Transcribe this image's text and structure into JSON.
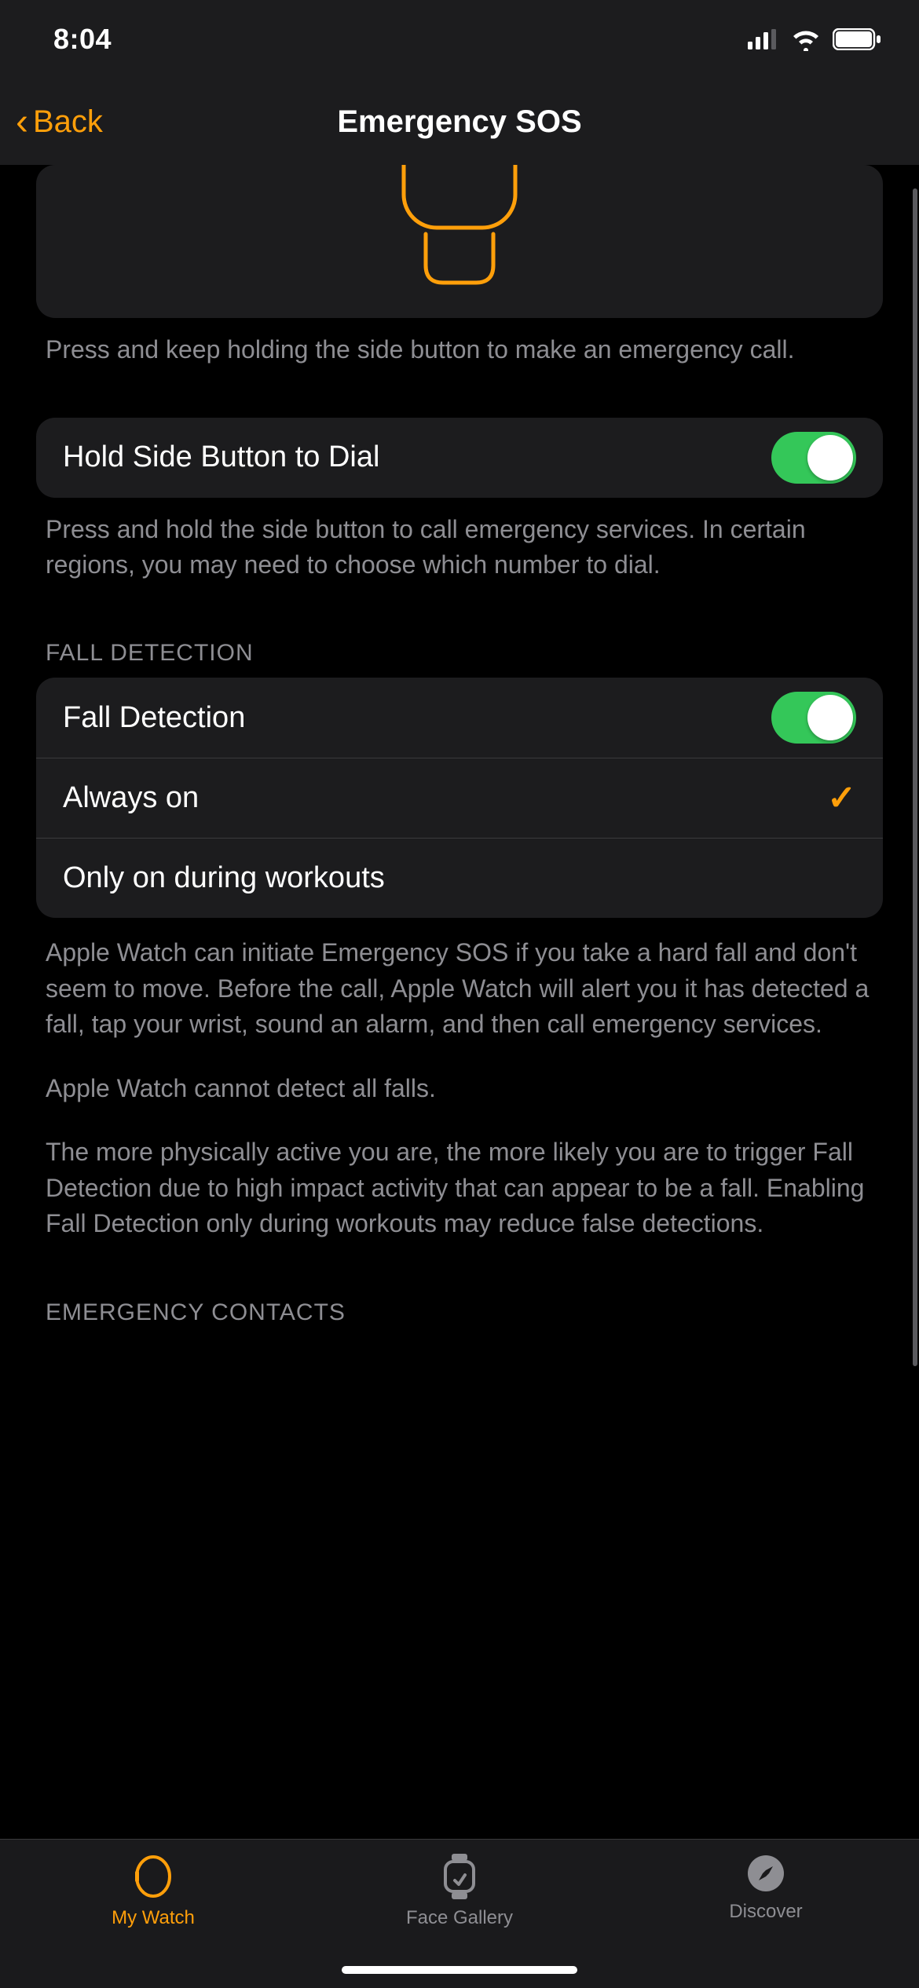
{
  "status": {
    "time": "8:04"
  },
  "nav": {
    "back": "Back",
    "title": "Emergency SOS"
  },
  "hero_footer": "Press and keep holding the side button to make an emergency call.",
  "hold_row": {
    "label": "Hold Side Button to Dial",
    "on": true
  },
  "hold_footer": "Press and hold the side button to call emergency services. In certain regions, you may need to choose which number to dial.",
  "fall_header": "FALL DETECTION",
  "fall": {
    "toggle_label": "Fall Detection",
    "toggle_on": true,
    "opt_always": "Always on",
    "opt_workouts": "Only on during workouts",
    "selected": "always"
  },
  "fall_footer": {
    "p1": "Apple Watch can initiate Emergency SOS if you take a hard fall and don't seem to move. Before the call, Apple Watch will alert you it has detected a fall, tap your wrist, sound an alarm, and then call emergency services.",
    "p2": "Apple Watch cannot detect all falls.",
    "p3": "The more physically active you are, the more likely you are to trigger Fall Detection due to high impact activity that can appear to be a fall. Enabling Fall Detection only during workouts may reduce false detections."
  },
  "contacts_header": "EMERGENCY CONTACTS",
  "tabs": {
    "watch": "My Watch",
    "gallery": "Face Gallery",
    "discover": "Discover"
  }
}
